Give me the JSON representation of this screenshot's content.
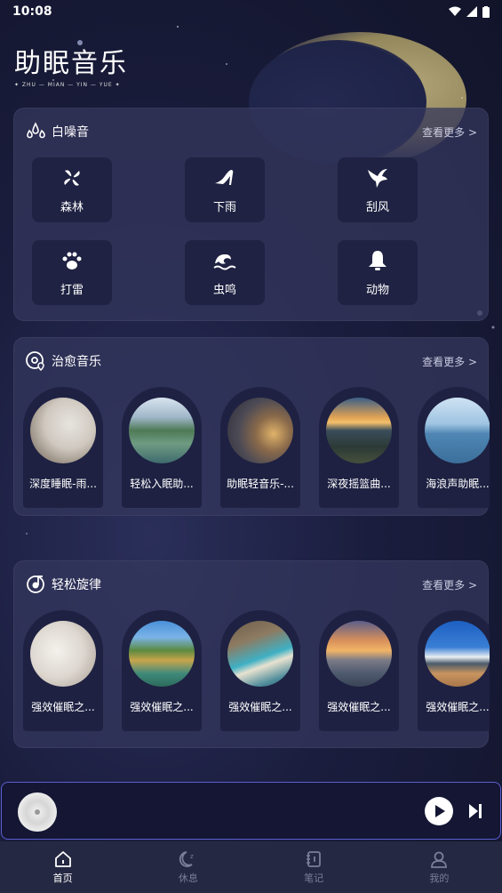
{
  "status": {
    "time": "10:08"
  },
  "app": {
    "title": "助眠音乐",
    "subtitle": "✦ ZHU — MIAN — YIN — YUE ✦"
  },
  "white_noise": {
    "title": "白噪音",
    "more": "查看更多 >",
    "items": [
      {
        "label": "森林",
        "icon": "fan-icon"
      },
      {
        "label": "下雨",
        "icon": "high-heel-icon"
      },
      {
        "label": "刮风",
        "icon": "bird-icon"
      },
      {
        "label": "打雷",
        "icon": "paw-icon"
      },
      {
        "label": "虫鸣",
        "icon": "wave-icon"
      },
      {
        "label": "动物",
        "icon": "bell-icon"
      }
    ]
  },
  "healing": {
    "title": "治愈音乐",
    "more": "查看更多 >",
    "items": [
      {
        "label": "深度睡眠-雨..."
      },
      {
        "label": "轻松入眠助..."
      },
      {
        "label": "助眠轻音乐-..."
      },
      {
        "label": "深夜摇篮曲..."
      },
      {
        "label": "海浪声助眠..."
      }
    ]
  },
  "relax": {
    "title": "轻松旋律",
    "more": "查看更多 >",
    "items": [
      {
        "label": "强效催眠之..."
      },
      {
        "label": "强效催眠之..."
      },
      {
        "label": "强效催眠之..."
      },
      {
        "label": "强效催眠之..."
      },
      {
        "label": "强效催眠之..."
      }
    ]
  },
  "tabs": [
    {
      "label": "首页",
      "icon": "home-icon",
      "active": true
    },
    {
      "label": "休息",
      "icon": "moon-icon",
      "active": false
    },
    {
      "label": "笔记",
      "icon": "notebook-icon",
      "active": false
    },
    {
      "label": "我的",
      "icon": "user-icon",
      "active": false
    }
  ],
  "colors": {
    "accent": "#5a5fd0",
    "card": "#34375c",
    "tile": "#1f2242"
  }
}
